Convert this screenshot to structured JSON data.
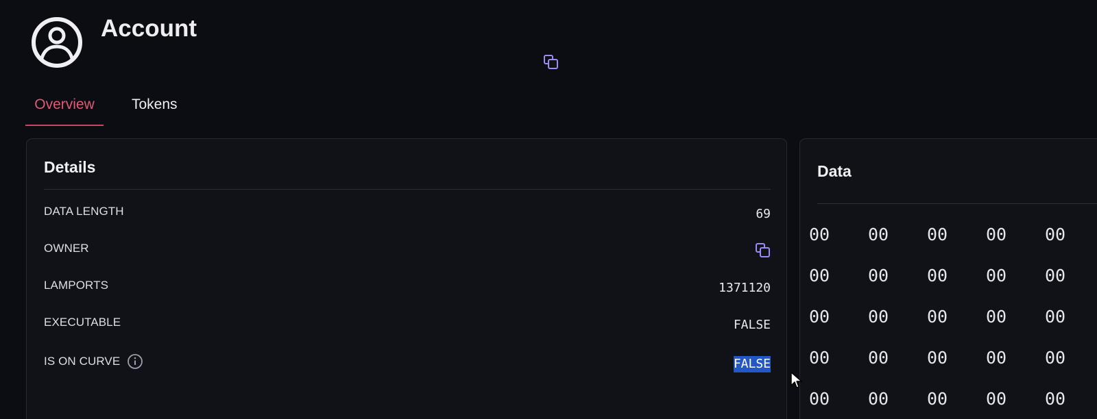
{
  "account": {
    "title": "Account"
  },
  "tabs": [
    {
      "label": "Overview",
      "active": true
    },
    {
      "label": "Tokens",
      "active": false
    }
  ],
  "details": {
    "title": "Details",
    "rows": [
      {
        "label": "DATA LENGTH",
        "value": "69"
      },
      {
        "label": "OWNER",
        "value": ""
      },
      {
        "label": "LAMPORTS",
        "value": "1371120"
      },
      {
        "label": "EXECUTABLE",
        "value": "FALSE"
      },
      {
        "label": "IS ON CURVE",
        "value": "FALSE"
      }
    ]
  },
  "data_panel": {
    "title": "Data",
    "hex": [
      "00",
      "00",
      "00",
      "00",
      "00",
      "00",
      "00",
      "00",
      "00",
      "00",
      "00",
      "00",
      "00",
      "00",
      "00",
      "00",
      "00",
      "00",
      "00",
      "00",
      "00",
      "00",
      "00",
      "00",
      "00"
    ]
  },
  "colors": {
    "background": "#0c0d12",
    "card": "#101218",
    "active_tab": "#e05a74",
    "copy_icon": "#9a8cf4",
    "selection": "#2357c6"
  },
  "icons": {
    "avatar": "user-circle-icon",
    "copy": "copy-icon",
    "info": "info-icon",
    "cursor": "mouse-pointer-icon"
  }
}
